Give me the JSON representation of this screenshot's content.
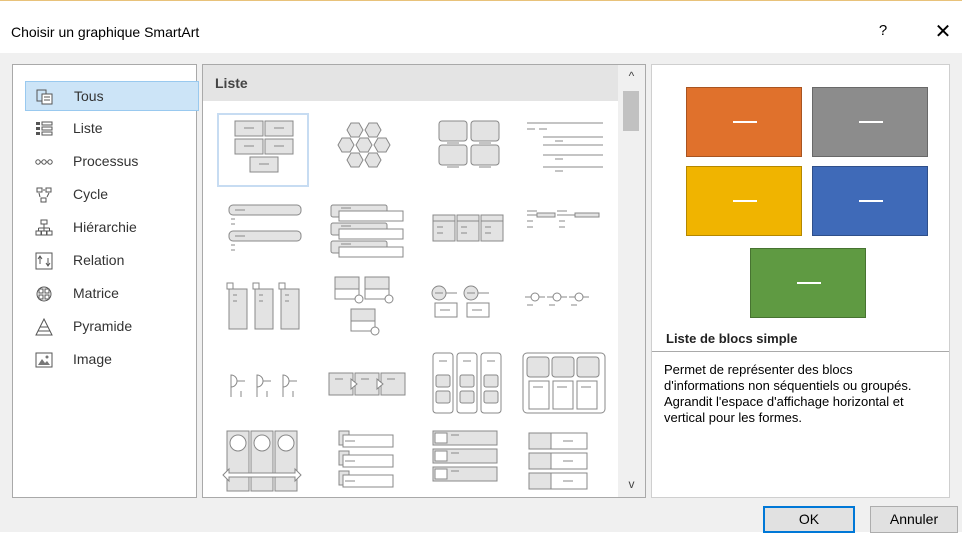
{
  "dialog": {
    "title": "Choisir un graphique SmartArt",
    "help_label": "?",
    "close_label": "✕"
  },
  "categories": [
    {
      "label": "Tous",
      "icon": "all-icon",
      "selected": true
    },
    {
      "label": "Liste",
      "icon": "list-icon"
    },
    {
      "label": "Processus",
      "icon": "process-icon"
    },
    {
      "label": "Cycle",
      "icon": "cycle-icon"
    },
    {
      "label": "Hiérarchie",
      "icon": "hierarchy-icon"
    },
    {
      "label": "Relation",
      "icon": "relation-icon"
    },
    {
      "label": "Matrice",
      "icon": "matrix-icon"
    },
    {
      "label": "Pyramide",
      "icon": "pyramid-icon"
    },
    {
      "label": "Image",
      "icon": "image-icon"
    }
  ],
  "gallery": {
    "section_label": "Liste",
    "scroll_up": "^",
    "scroll_down": "v"
  },
  "preview": {
    "name": "Liste de blocs simple",
    "description": "Permet de représenter des blocs d'informations non séquentiels ou groupés. Agrandit l'espace d'affichage horizontal et vertical pour les formes.",
    "colors": [
      "#e0712c",
      "#8c8c8c",
      "#f0b400",
      "#3f6ab8",
      "#5f9a42"
    ]
  },
  "buttons": {
    "ok": "OK",
    "cancel": "Annuler"
  }
}
